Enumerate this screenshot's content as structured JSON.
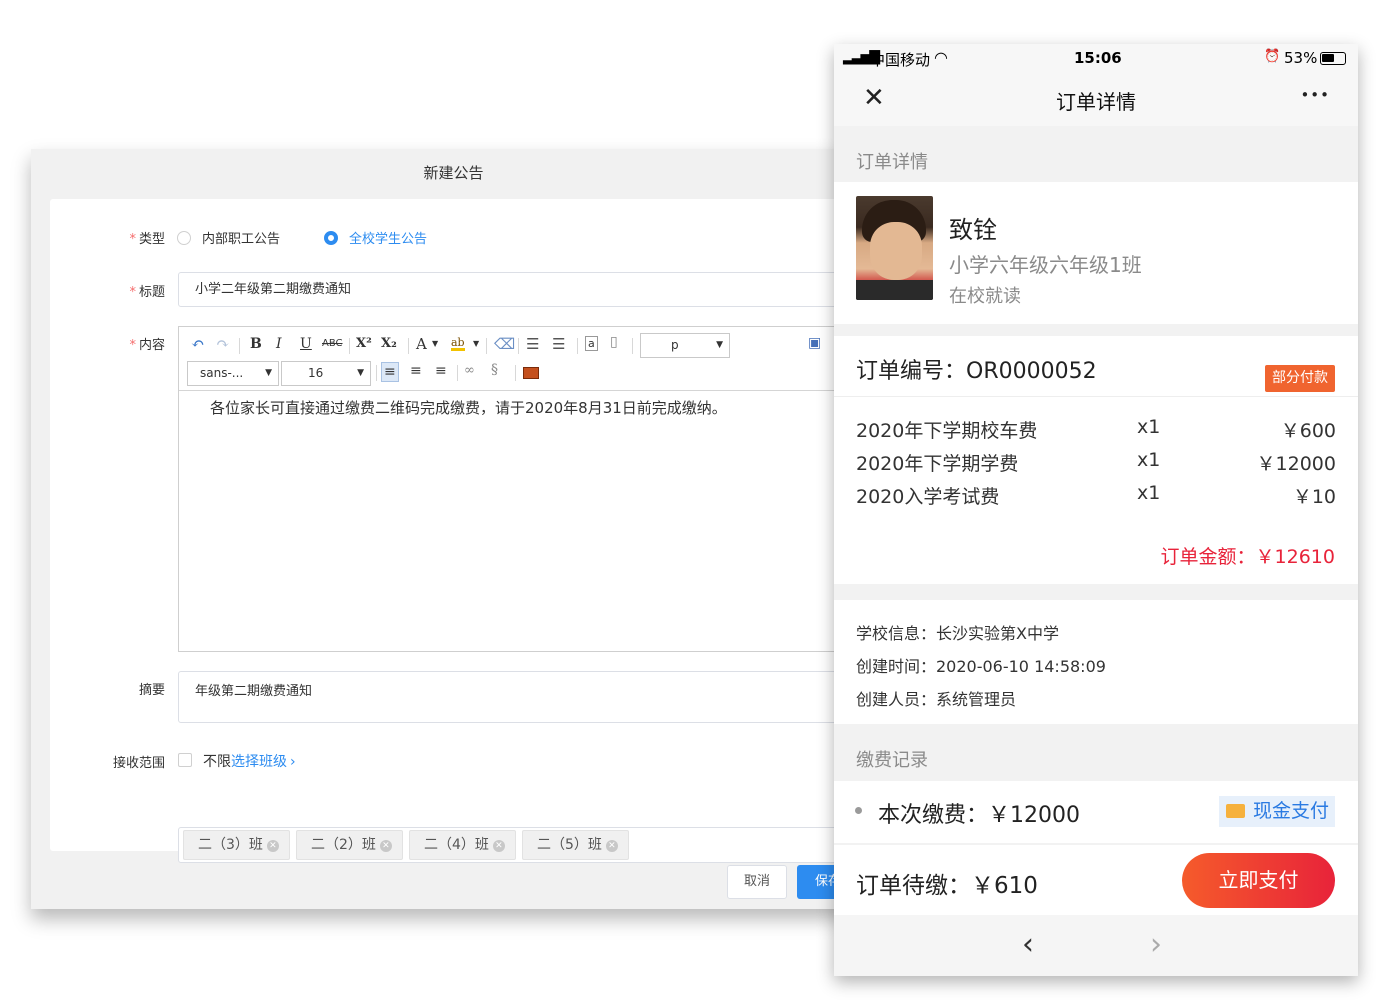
{
  "dialog": {
    "title": "新建公告",
    "required_mark": "*",
    "type": {
      "label": "类型",
      "options": [
        "内部职工公告",
        "全校学生公告"
      ],
      "selected": "全校学生公告"
    },
    "title_field": {
      "label": "标题",
      "value": "小学二年级第二期缴费通知"
    },
    "content": {
      "label": "内容",
      "toolbar": {
        "undo": "↶",
        "redo": "↷",
        "bold": "B",
        "italic": "I",
        "underline": "U",
        "strike": "ABC",
        "superscript": "X²",
        "subscript": "X₂",
        "font_color": "A",
        "highlight": "ab",
        "format_select": "p",
        "font_select": "sans-...",
        "size_select": "16"
      },
      "text": "各位家长可直接通过缴费二维码完成缴费，请于2020年8月31日前完成缴纳。"
    },
    "summary": {
      "label": "摘要",
      "value": "年级第二期缴费通知"
    },
    "scope": {
      "label": "接收范围",
      "unlimited": "不限",
      "select_class": "选择班级",
      "tags": [
        "二（3）班",
        "二（2）班",
        "二（4）班",
        "二（5）班"
      ]
    },
    "buttons": {
      "cancel": "取消",
      "save": "保存"
    }
  },
  "phone": {
    "status": {
      "carrier": "中国移动",
      "time": "15:06",
      "battery": "53%"
    },
    "nav": {
      "title": "订单详情",
      "close_icon": "close-icon",
      "more": "•••"
    },
    "section_order": "订单详情",
    "student": {
      "name": "致铨",
      "class": "小学六年级六年级1班",
      "status": "在校就读"
    },
    "order": {
      "number_label": "订单编号：",
      "number": "OR0000052",
      "badge": "部分付款",
      "items": [
        {
          "name": "2020年下学期校车费",
          "qty": "x1",
          "price": "￥600"
        },
        {
          "name": "2020年下学期学费",
          "qty": "x1",
          "price": "￥12000"
        },
        {
          "name": "2020入学考试费",
          "qty": "x1",
          "price": "￥10"
        }
      ],
      "total": "订单金额：￥12610"
    },
    "info": [
      "学校信息：长沙实验第X中学",
      "创建时间：2020-06-10 14:58:09",
      "创建人员：系统管理员"
    ],
    "section_records": "缴费记录",
    "record": {
      "text": "本次缴费：￥12000",
      "method": "现金支付"
    },
    "footer": {
      "pending": "订单待缴：￥610",
      "pay_button": "立即支付"
    },
    "colors": {
      "accent_red": "#e8233a",
      "badge_orange": "#f0642f",
      "link_blue": "#2d8cf0"
    }
  }
}
